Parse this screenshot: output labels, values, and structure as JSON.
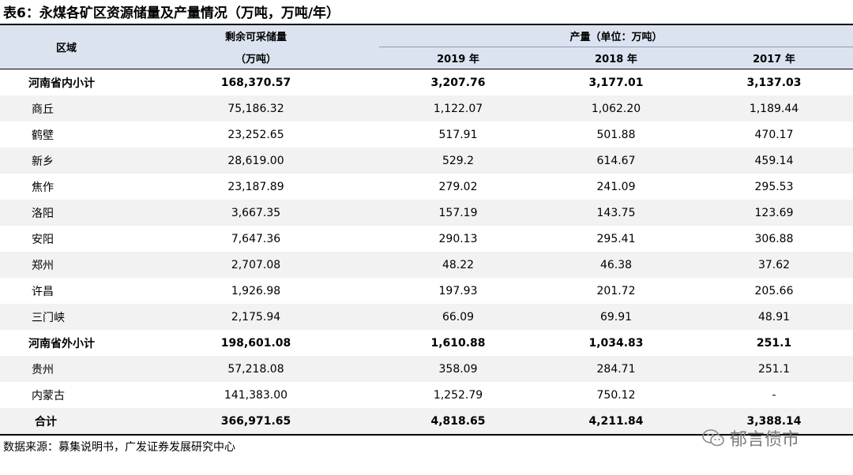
{
  "title": "表6：永煤各矿区资源储量及产量情况（万吨，万吨/年）",
  "header": {
    "region": "区域",
    "reserves_line1": "剩余可采储量",
    "reserves_line2": "（万吨）",
    "production": "产量（单位：万吨）",
    "years": [
      "2019 年",
      "2018 年",
      "2017 年"
    ]
  },
  "rows": [
    {
      "region": "河南省内小计",
      "reserves": "168,370.57",
      "y2019": "3,207.76",
      "y2018": "3,177.01",
      "y2017": "3,137.03",
      "bold": true
    },
    {
      "region": "商丘",
      "reserves": "75,186.32",
      "y2019": "1,122.07",
      "y2018": "1,062.20",
      "y2017": "1,189.44",
      "bold": false
    },
    {
      "region": "鹤壁",
      "reserves": "23,252.65",
      "y2019": "517.91",
      "y2018": "501.88",
      "y2017": "470.17",
      "bold": false
    },
    {
      "region": "新乡",
      "reserves": "28,619.00",
      "y2019": "529.2",
      "y2018": "614.67",
      "y2017": "459.14",
      "bold": false
    },
    {
      "region": "焦作",
      "reserves": "23,187.89",
      "y2019": "279.02",
      "y2018": "241.09",
      "y2017": "295.53",
      "bold": false
    },
    {
      "region": "洛阳",
      "reserves": "3,667.35",
      "y2019": "157.19",
      "y2018": "143.75",
      "y2017": "123.69",
      "bold": false
    },
    {
      "region": "安阳",
      "reserves": "7,647.36",
      "y2019": "290.13",
      "y2018": "295.41",
      "y2017": "306.88",
      "bold": false
    },
    {
      "region": "郑州",
      "reserves": "2,707.08",
      "y2019": "48.22",
      "y2018": "46.38",
      "y2017": "37.62",
      "bold": false
    },
    {
      "region": "许昌",
      "reserves": "1,926.98",
      "y2019": "197.93",
      "y2018": "201.72",
      "y2017": "205.66",
      "bold": false
    },
    {
      "region": "三门峡",
      "reserves": "2,175.94",
      "y2019": "66.09",
      "y2018": "69.91",
      "y2017": "48.91",
      "bold": false
    },
    {
      "region": "河南省外小计",
      "reserves": "198,601.08",
      "y2019": "1,610.88",
      "y2018": "1,034.83",
      "y2017": "251.1",
      "bold": true
    },
    {
      "region": "贵州",
      "reserves": "57,218.08",
      "y2019": "358.09",
      "y2018": "284.71",
      "y2017": "251.1",
      "bold": false
    },
    {
      "region": "内蒙古",
      "reserves": "141,383.00",
      "y2019": "1,252.79",
      "y2018": "750.12",
      "y2017": "-",
      "bold": false
    },
    {
      "region": "合计",
      "reserves": "366,971.65",
      "y2019": "4,818.65",
      "y2018": "4,211.84",
      "y2017": "3,388.14",
      "bold": true
    }
  ],
  "footer": "数据来源：募集说明书，广发证券发展研究中心",
  "watermark": "郁言债市",
  "colors": {
    "header_bg": "#dce3f0",
    "row_shade": "#f2f2f2",
    "watermark": "#7a7a7a"
  }
}
